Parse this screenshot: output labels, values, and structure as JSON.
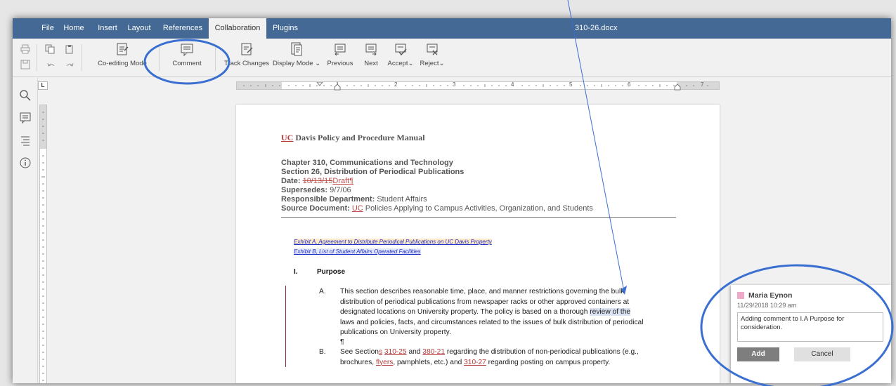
{
  "window": {
    "doc_title": "310-26.docx"
  },
  "menu": {
    "tabs": [
      "File",
      "Home",
      "Insert",
      "Layout",
      "References",
      "Collaboration",
      "Plugins"
    ],
    "active": "Collaboration"
  },
  "toolbar": {
    "coediting": "Co-editing Mode",
    "comment": "Comment",
    "track_changes": "Track Changes",
    "display_mode": "Display Mode",
    "previous": "Previous",
    "next": "Next",
    "accept": "Accept",
    "reject": "Reject"
  },
  "ruler": {
    "corner": "L",
    "numbers": [
      "1",
      "2",
      "3",
      "4",
      "5",
      "6",
      "7"
    ]
  },
  "document": {
    "title_prefix": "UC",
    "title_rest": " Davis Policy and Procedure Manual",
    "chapter": "Chapter 310, Communications and Technology",
    "section": "Section 26, Distribution of Periodical Publications",
    "date_label": "Date: ",
    "date_deleted": "10/13/15",
    "date_inserted": "Draft¶",
    "supersedes_label": "Supersedes: ",
    "supersedes_value": "9/7/06",
    "dept_label": "Responsible Department: ",
    "dept_value": "Student Affairs",
    "source_label": "Source Document: ",
    "source_uc": "UC",
    "source_rest": " Policies Applying to Campus Activities, Organization, and Students",
    "exhibit_a": "Exhibit A, Agreement to Distribute Periodical Publications on UC Davis Property",
    "exhibit_b": "Exhibit B, List of Student Affairs Operated Facilities",
    "section_num": "I.",
    "section_title": "Purpose",
    "item_a_letter": "A.",
    "item_a_line1": "This section describes reasonable time, place, and manner restrictions governing the bulk",
    "item_a_line2": "distribution of periodical publications from newspaper racks or other approved containers at",
    "item_a_line3_pre": "designated locations on University property. The policy is based on a thorough ",
    "item_a_line3_sel": "review of the",
    "item_a_line4": "laws and policies, facts, and circumstances related to the issues of bulk distribution of periodical",
    "item_a_line5": "publications on University property.",
    "pilcrow": "¶",
    "item_b_letter": "B.",
    "item_b_pre": "See Section",
    "item_b_s": "s",
    "item_b_link1": "310-25",
    "item_b_and": " and ",
    "item_b_link2": "380-21",
    "item_b_rest": " regarding the distribution of non-periodical publications (e.g.,",
    "item_b_line2_pre": "brochures, ",
    "item_b_flyers": "flyers",
    "item_b_line2_mid": ", pamphlets, etc.) and ",
    "item_b_link3": "310-27",
    "item_b_line2_end": " regarding posting on campus property."
  },
  "comment": {
    "user": "Maria Eynon",
    "date": "11/29/2018 10:29 am",
    "text": "Adding comment to I.A Purpose for consideration.",
    "add_label": "Add",
    "cancel_label": "Cancel",
    "user_color": "#f0a8c8"
  },
  "colors": {
    "menubar": "#446995",
    "annotation": "#3a6fd1",
    "tracked_change": "#c0504d"
  }
}
